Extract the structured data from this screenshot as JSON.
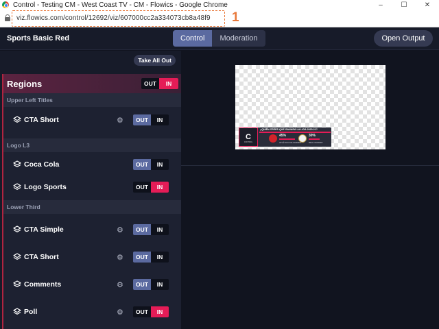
{
  "browser": {
    "window_title": "Control - Testing CM - West Coast TV - CM - Flowics - Google Chrome",
    "url": "viz.flowics.com/control/12692/viz/607000cc2a334073cb8a48f9",
    "callout_number": "1",
    "controls": {
      "minimize": "–",
      "maximize": "☐",
      "close": "✕"
    }
  },
  "header": {
    "title": "Sports Basic Red",
    "tabs": [
      {
        "label": "Control",
        "active": true
      },
      {
        "label": "Moderation",
        "active": false
      }
    ],
    "open_output_label": "Open Output"
  },
  "panel": {
    "take_all_out_label": "Take All Out",
    "regions_title": "Regions",
    "regions_toggle": {
      "out": "OUT",
      "in": "IN",
      "state": "in"
    },
    "groups": [
      {
        "label": "Upper Left Titles",
        "items": [
          {
            "label": "CTA Short",
            "settings": true,
            "state": "out"
          }
        ]
      },
      {
        "label": "Logo L3",
        "items": [
          {
            "label": "Coca Cola",
            "settings": false,
            "state": "out"
          },
          {
            "label": "Logo Sports",
            "settings": false,
            "state": "in"
          }
        ]
      },
      {
        "label": "Lower Third",
        "items": [
          {
            "label": "CTA Simple",
            "settings": true,
            "state": "out"
          },
          {
            "label": "CTA Short",
            "settings": true,
            "state": "out"
          },
          {
            "label": "Comments",
            "settings": true,
            "state": "out"
          },
          {
            "label": "Poll",
            "settings": true,
            "state": "in"
          }
        ]
      }
    ],
    "toggle_labels": {
      "out": "OUT",
      "in": "IN"
    }
  },
  "preview": {
    "poll_logo_text": "C",
    "poll_logo_caption": "CONTROL",
    "question": "¿QUIÉN CREES QUE GANARÁ LA LIGA 2020-21?",
    "team1": {
      "pct": "45%",
      "name": "ATLÉTICO DE MADRID",
      "percent": 45,
      "color": "#d2232a"
    },
    "team2": {
      "pct": "30%",
      "name": "REAL MADRID",
      "percent": 30,
      "color": "#f2f2f2"
    }
  },
  "colors": {
    "accent_in": "#e51c57",
    "accent_out": "#5b6aa0",
    "callout": "#e8783a"
  }
}
